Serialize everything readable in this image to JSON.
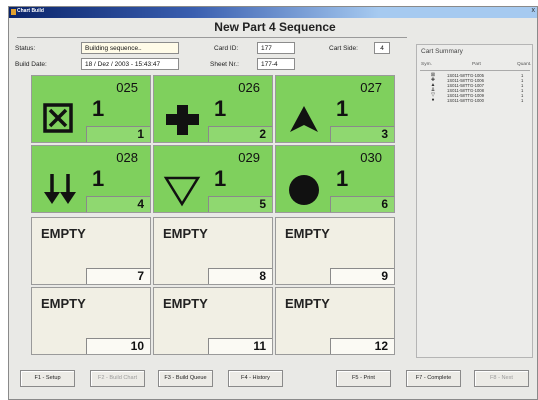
{
  "window": {
    "title": "Chart Build",
    "close_glyph": "x"
  },
  "heading": "New Part 4 Sequence",
  "form": {
    "status_label": "Status:",
    "status_value": "Building sequence..",
    "build_date_label": "Build Date:",
    "build_date_value": "18 / Dez / 2003 - 15:43:47",
    "card_id_label": "Card ID:",
    "card_id_value": "177",
    "sheet_nr_label": "Sheet Nr.:",
    "sheet_nr_value": "177-4",
    "cart_side_label": "Cart Side:",
    "cart_side_value": "4"
  },
  "grid": {
    "cells": [
      {
        "code": "025",
        "qty": "1",
        "pos": "1",
        "icon": "crossed-box-icon",
        "empty": false
      },
      {
        "code": "026",
        "qty": "1",
        "pos": "2",
        "icon": "plus-icon",
        "empty": false
      },
      {
        "code": "027",
        "qty": "1",
        "pos": "3",
        "icon": "arrowhead-icon",
        "empty": false
      },
      {
        "code": "028",
        "qty": "1",
        "pos": "4",
        "icon": "double-down-arrow-icon",
        "empty": false
      },
      {
        "code": "029",
        "qty": "1",
        "pos": "5",
        "icon": "down-triangle-icon",
        "empty": false
      },
      {
        "code": "030",
        "qty": "1",
        "pos": "6",
        "icon": "filled-circle-icon",
        "empty": false
      },
      {
        "label": "EMPTY",
        "pos": "7",
        "empty": true
      },
      {
        "label": "EMPTY",
        "pos": "8",
        "empty": true
      },
      {
        "label": "EMPTY",
        "pos": "9",
        "empty": true
      },
      {
        "label": "EMPTY",
        "pos": "10",
        "empty": true
      },
      {
        "label": "EMPTY",
        "pos": "11",
        "empty": true
      },
      {
        "label": "EMPTY",
        "pos": "12",
        "empty": true
      }
    ]
  },
  "summary": {
    "title": "Cart Summary",
    "headers": {
      "sym": "Sym.",
      "part": "Part",
      "quant": "Quant."
    },
    "rows": [
      {
        "sym": "⊠",
        "part": "1S011-58TTG-1005",
        "quant": "1"
      },
      {
        "sym": "✚",
        "part": "1S011-58TTG-1006",
        "quant": "1"
      },
      {
        "sym": "▲",
        "part": "1S011-58TTG-1007",
        "quant": "1"
      },
      {
        "sym": "⇊",
        "part": "1S011-58TTG-1008",
        "quant": "1"
      },
      {
        "sym": "▽",
        "part": "1S011-58TTG-1009",
        "quant": "1"
      },
      {
        "sym": "●",
        "part": "1S011-58TTG-1000",
        "quant": "1"
      }
    ]
  },
  "buttons": [
    {
      "label": "F1 - Setup",
      "enabled": true
    },
    {
      "label": "F2 - Build Chart",
      "enabled": false
    },
    {
      "label": "F3 - Build Queue",
      "enabled": true
    },
    {
      "label": "F4 - History",
      "enabled": true
    },
    {
      "label": "F5 - Print",
      "enabled": true
    },
    {
      "label": "F7 - Complete",
      "enabled": true
    },
    {
      "label": "F8 - Next",
      "enabled": false
    }
  ],
  "colors": {
    "filled_cell": "#7fd05d",
    "empty_cell": "#f1efe4",
    "titlebar": "#0a246a"
  }
}
